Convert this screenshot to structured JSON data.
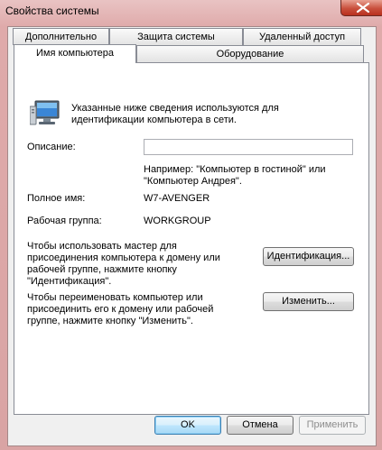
{
  "window": {
    "title": "Свойства системы"
  },
  "tabs": {
    "row_back": [
      "Дополнительно",
      "Защита системы",
      "Удаленный доступ"
    ],
    "row_front": [
      "Имя компьютера",
      "Оборудование"
    ],
    "active": "Имя компьютера"
  },
  "panel": {
    "intro": [
      "Указанные ниже сведения используются для",
      "идентификации компьютера в сети."
    ],
    "description_label": "Описание:",
    "description_value": "",
    "example": [
      "Например: \"Компьютер в гостиной\" или",
      "\"Компьютер Андрея\"."
    ],
    "fullname_label": "Полное имя:",
    "fullname_value": "W7-AVENGER",
    "workgroup_label": "Рабочая группа:",
    "workgroup_value": "WORKGROUP",
    "wizard_text": [
      "Чтобы использовать мастер для",
      "присоединения компьютера к домену или",
      "рабочей группе, нажмите кнопку",
      "\"Идентификация\"."
    ],
    "identify_button": "Идентификация...",
    "rename_text": [
      "Чтобы переименовать компьютер или",
      "присоединить его к домену или рабочей",
      "группе, нажмите кнопку \"Изменить\"."
    ],
    "change_button": "Изменить..."
  },
  "footer": {
    "ok": "OK",
    "cancel": "Отмена",
    "apply": "Применить"
  }
}
